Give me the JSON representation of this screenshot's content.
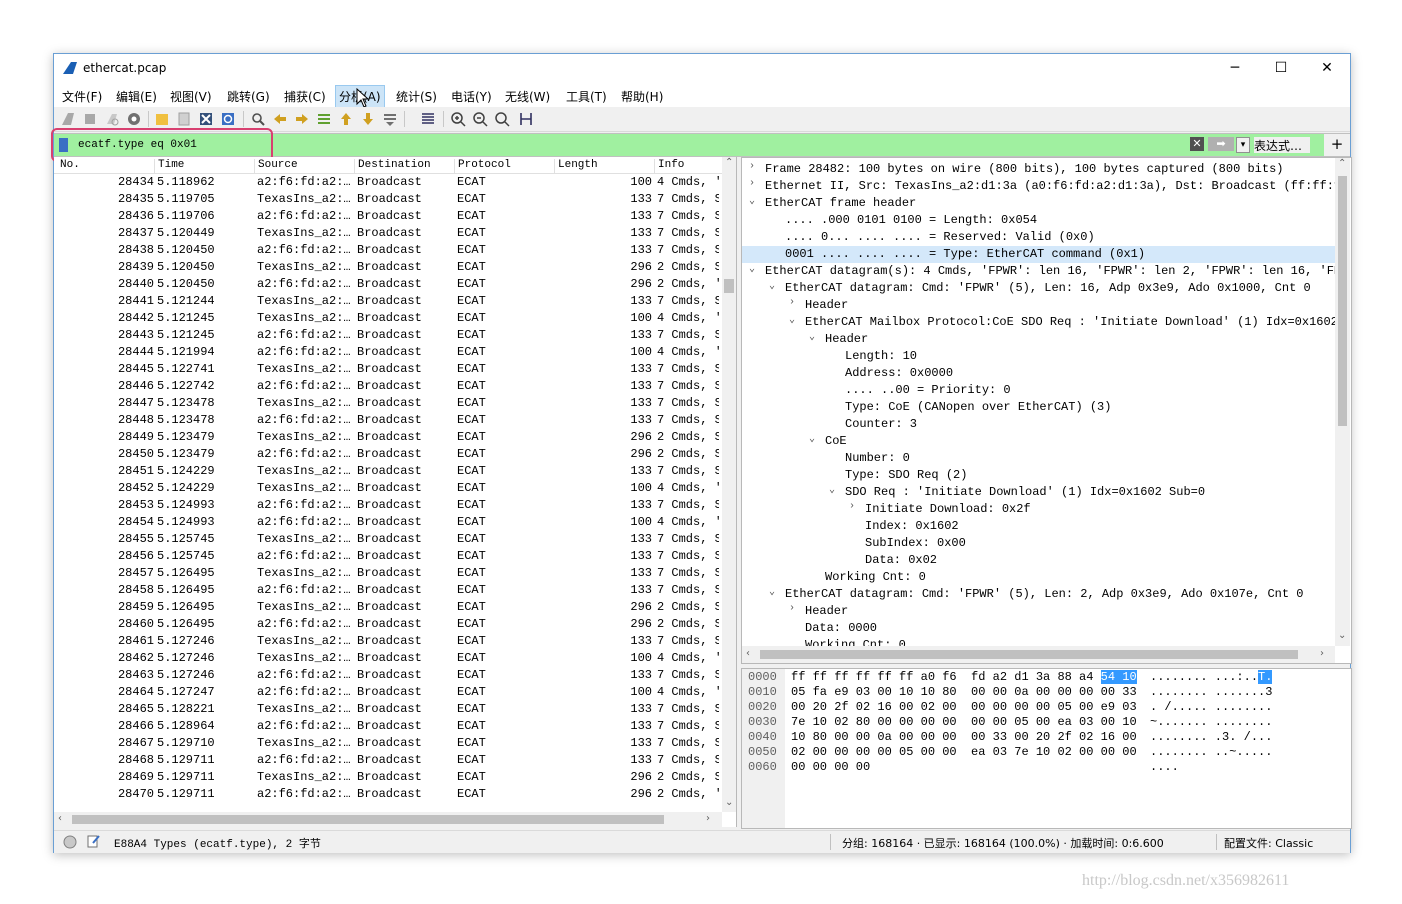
{
  "window": {
    "title": "ethercat.pcap",
    "controls": {
      "minimize": "─",
      "maximize": "☐",
      "close": "✕"
    }
  },
  "menu": [
    "文件(F)",
    "编辑(E)",
    "视图(V)",
    "跳转(G)",
    "捕获(C)",
    "分析(A)",
    "统计(S)",
    "电话(Y)",
    "无线(W)",
    "工具(T)",
    "帮助(H)"
  ],
  "filter": {
    "value": "ecatf.type eq 0x01",
    "expression_label": "表达式…",
    "add_label": "+",
    "clear_label": "✕",
    "apply_label": "➡",
    "dropdown_label": "▾"
  },
  "packet_list": {
    "columns": [
      "No.",
      "Time",
      "Source",
      "Destination",
      "Protocol",
      "Length",
      "Info"
    ],
    "rows": [
      [
        "28434",
        "5.118962",
        "a2:f6:fd:a2:…",
        "Broadcast",
        "ECAT",
        "100",
        "4 Cmds, '"
      ],
      [
        "28435",
        "5.119705",
        "TexasIns_a2:…",
        "Broadcast",
        "ECAT",
        "133",
        "7 Cmds, S"
      ],
      [
        "28436",
        "5.119706",
        "a2:f6:fd:a2:…",
        "Broadcast",
        "ECAT",
        "133",
        "7 Cmds, S"
      ],
      [
        "28437",
        "5.120449",
        "TexasIns_a2:…",
        "Broadcast",
        "ECAT",
        "133",
        "7 Cmds, S"
      ],
      [
        "28438",
        "5.120450",
        "a2:f6:fd:a2:…",
        "Broadcast",
        "ECAT",
        "133",
        "7 Cmds, S"
      ],
      [
        "28439",
        "5.120450",
        "TexasIns_a2:…",
        "Broadcast",
        "ECAT",
        "296",
        "2 Cmds, S"
      ],
      [
        "28440",
        "5.120450",
        "a2:f6:fd:a2:…",
        "Broadcast",
        "ECAT",
        "296",
        "2 Cmds, '"
      ],
      [
        "28441",
        "5.121244",
        "TexasIns_a2:…",
        "Broadcast",
        "ECAT",
        "133",
        "7 Cmds, S"
      ],
      [
        "28442",
        "5.121245",
        "TexasIns_a2:…",
        "Broadcast",
        "ECAT",
        "100",
        "4 Cmds, '"
      ],
      [
        "28443",
        "5.121245",
        "a2:f6:fd:a2:…",
        "Broadcast",
        "ECAT",
        "133",
        "7 Cmds, S"
      ],
      [
        "28444",
        "5.121994",
        "a2:f6:fd:a2:…",
        "Broadcast",
        "ECAT",
        "100",
        "4 Cmds, '"
      ],
      [
        "28445",
        "5.122741",
        "TexasIns_a2:…",
        "Broadcast",
        "ECAT",
        "133",
        "7 Cmds, S"
      ],
      [
        "28446",
        "5.122742",
        "a2:f6:fd:a2:…",
        "Broadcast",
        "ECAT",
        "133",
        "7 Cmds, S"
      ],
      [
        "28447",
        "5.123478",
        "TexasIns_a2:…",
        "Broadcast",
        "ECAT",
        "133",
        "7 Cmds, S"
      ],
      [
        "28448",
        "5.123478",
        "a2:f6:fd:a2:…",
        "Broadcast",
        "ECAT",
        "133",
        "7 Cmds, S"
      ],
      [
        "28449",
        "5.123479",
        "TexasIns_a2:…",
        "Broadcast",
        "ECAT",
        "296",
        "2 Cmds, S"
      ],
      [
        "28450",
        "5.123479",
        "a2:f6:fd:a2:…",
        "Broadcast",
        "ECAT",
        "296",
        "2 Cmds, S"
      ],
      [
        "28451",
        "5.124229",
        "TexasIns_a2:…",
        "Broadcast",
        "ECAT",
        "133",
        "7 Cmds, S"
      ],
      [
        "28452",
        "5.124229",
        "TexasIns_a2:…",
        "Broadcast",
        "ECAT",
        "100",
        "4 Cmds, '"
      ],
      [
        "28453",
        "5.124993",
        "a2:f6:fd:a2:…",
        "Broadcast",
        "ECAT",
        "133",
        "7 Cmds, S"
      ],
      [
        "28454",
        "5.124993",
        "a2:f6:fd:a2:…",
        "Broadcast",
        "ECAT",
        "100",
        "4 Cmds, '"
      ],
      [
        "28455",
        "5.125745",
        "TexasIns_a2:…",
        "Broadcast",
        "ECAT",
        "133",
        "7 Cmds, S"
      ],
      [
        "28456",
        "5.125745",
        "a2:f6:fd:a2:…",
        "Broadcast",
        "ECAT",
        "133",
        "7 Cmds, S"
      ],
      [
        "28457",
        "5.126495",
        "TexasIns_a2:…",
        "Broadcast",
        "ECAT",
        "133",
        "7 Cmds, S"
      ],
      [
        "28458",
        "5.126495",
        "a2:f6:fd:a2:…",
        "Broadcast",
        "ECAT",
        "133",
        "7 Cmds, S"
      ],
      [
        "28459",
        "5.126495",
        "TexasIns_a2:…",
        "Broadcast",
        "ECAT",
        "296",
        "2 Cmds, S"
      ],
      [
        "28460",
        "5.126495",
        "a2:f6:fd:a2:…",
        "Broadcast",
        "ECAT",
        "296",
        "2 Cmds, S"
      ],
      [
        "28461",
        "5.127246",
        "TexasIns_a2:…",
        "Broadcast",
        "ECAT",
        "133",
        "7 Cmds, S"
      ],
      [
        "28462",
        "5.127246",
        "TexasIns_a2:…",
        "Broadcast",
        "ECAT",
        "100",
        "4 Cmds, '"
      ],
      [
        "28463",
        "5.127246",
        "a2:f6:fd:a2:…",
        "Broadcast",
        "ECAT",
        "133",
        "7 Cmds, S"
      ],
      [
        "28464",
        "5.127247",
        "a2:f6:fd:a2:…",
        "Broadcast",
        "ECAT",
        "100",
        "4 Cmds, '"
      ],
      [
        "28465",
        "5.128221",
        "TexasIns_a2:…",
        "Broadcast",
        "ECAT",
        "133",
        "7 Cmds, S"
      ],
      [
        "28466",
        "5.128964",
        "a2:f6:fd:a2:…",
        "Broadcast",
        "ECAT",
        "133",
        "7 Cmds, S"
      ],
      [
        "28467",
        "5.129710",
        "TexasIns_a2:…",
        "Broadcast",
        "ECAT",
        "133",
        "7 Cmds, S"
      ],
      [
        "28468",
        "5.129711",
        "a2:f6:fd:a2:…",
        "Broadcast",
        "ECAT",
        "133",
        "7 Cmds, S"
      ],
      [
        "28469",
        "5.129711",
        "TexasIns_a2:…",
        "Broadcast",
        "ECAT",
        "296",
        "2 Cmds, S"
      ],
      [
        "28470",
        "5.129711",
        "a2:f6:fd:a2:…",
        "Broadcast",
        "ECAT",
        "296",
        "2 Cmds, '"
      ]
    ]
  },
  "details": [
    {
      "text": "Frame 28482: 100 bytes on wire (800 bits), 100 bytes captured (800 bits)",
      "depth": 0,
      "twist": "›"
    },
    {
      "text": "Ethernet II, Src: TexasIns_a2:d1:3a (a0:f6:fd:a2:d1:3a), Dst: Broadcast (ff:ff:ff",
      "depth": 0,
      "twist": "›"
    },
    {
      "text": "EtherCAT frame header",
      "depth": 0,
      "twist": "⌄"
    },
    {
      "text": ".... .000 0101 0100 = Length: 0x054",
      "depth": 1,
      "twist": ""
    },
    {
      "text": ".... 0... .... .... = Reserved: Valid (0x0)",
      "depth": 1,
      "twist": ""
    },
    {
      "text": "0001 .... .... .... = Type: EtherCAT command (0x1)",
      "depth": 1,
      "twist": "",
      "selected": true
    },
    {
      "text": "EtherCAT datagram(s): 4 Cmds, 'FPWR': len 16, 'FPWR': len 2, 'FPWR': len 16, 'FPW",
      "depth": 0,
      "twist": "⌄"
    },
    {
      "text": "EtherCAT datagram: Cmd: 'FPWR' (5), Len: 16, Adp 0x3e9, Ado 0x1000, Cnt 0",
      "depth": 1,
      "twist": "⌄"
    },
    {
      "text": "Header",
      "depth": 2,
      "twist": "›"
    },
    {
      "text": "EtherCAT Mailbox Protocol:CoE SDO Req : 'Initiate Download' (1) Idx=0x1602 S",
      "depth": 2,
      "twist": "⌄"
    },
    {
      "text": "Header",
      "depth": 3,
      "twist": "⌄"
    },
    {
      "text": "Length: 10",
      "depth": 4,
      "twist": ""
    },
    {
      "text": "Address: 0x0000",
      "depth": 4,
      "twist": ""
    },
    {
      "text": ".... ..00 = Priority: 0",
      "depth": 4,
      "twist": ""
    },
    {
      "text": "Type: CoE (CANopen over EtherCAT) (3)",
      "depth": 4,
      "twist": ""
    },
    {
      "text": "Counter: 3",
      "depth": 4,
      "twist": ""
    },
    {
      "text": "CoE",
      "depth": 3,
      "twist": "⌄"
    },
    {
      "text": "Number: 0",
      "depth": 4,
      "twist": ""
    },
    {
      "text": "Type: SDO Req (2)",
      "depth": 4,
      "twist": ""
    },
    {
      "text": "SDO Req : 'Initiate Download' (1) Idx=0x1602 Sub=0",
      "depth": 4,
      "twist": "⌄"
    },
    {
      "text": "Initiate Download: 0x2f",
      "depth": 5,
      "twist": "›"
    },
    {
      "text": "Index: 0x1602",
      "depth": 5,
      "twist": ""
    },
    {
      "text": "SubIndex: 0x00",
      "depth": 5,
      "twist": ""
    },
    {
      "text": "Data: 0x02",
      "depth": 5,
      "twist": ""
    },
    {
      "text": "Working Cnt: 0",
      "depth": 3,
      "twist": ""
    },
    {
      "text": "EtherCAT datagram: Cmd: 'FPWR' (5), Len: 2, Adp 0x3e9, Ado 0x107e, Cnt 0",
      "depth": 1,
      "twist": "⌄"
    },
    {
      "text": "Header",
      "depth": 2,
      "twist": "›"
    },
    {
      "text": "Data: 0000",
      "depth": 2,
      "twist": ""
    },
    {
      "text": "Working Cnt: 0",
      "depth": 2,
      "twist": ""
    }
  ],
  "hex": [
    {
      "off": "0000",
      "pre": "ff ff ff ff ff ff a0 f6  fd a2 d1 3a 88 a4 ",
      "hl": "54 10",
      "apre": "........ ...:..",
      "ahl": "T."
    },
    {
      "off": "0010",
      "pre": "05 fa e9 03 00 10 10 80  00 00 0a 00 00 00 00 33",
      "hl": "",
      "apre": "........ .......3",
      "ahl": ""
    },
    {
      "off": "0020",
      "pre": "00 20 2f 02 16 00 02 00  00 00 00 00 05 00 e9 03",
      "hl": "",
      "apre": ". /..... ........",
      "ahl": ""
    },
    {
      "off": "0030",
      "pre": "7e 10 02 80 00 00 00 00  00 00 05 00 ea 03 00 10",
      "hl": "",
      "apre": "~....... ........",
      "ahl": ""
    },
    {
      "off": "0040",
      "pre": "10 80 00 00 0a 00 00 00  00 33 00 20 2f 02 16 00",
      "hl": "",
      "apre": "........ .3. /...",
      "ahl": ""
    },
    {
      "off": "0050",
      "pre": "02 00 00 00 00 05 00 00  ea 03 7e 10 02 00 00 00",
      "hl": "",
      "apre": "........ ..~.....",
      "ahl": ""
    },
    {
      "off": "0060",
      "pre": "00 00 00 00",
      "hl": "",
      "apre": "....",
      "ahl": ""
    }
  ],
  "status": {
    "field_info": "E88A4 Types (ecatf.type), 2 字节",
    "packets": "分组: 168164 · 已显示: 168164 (100.0%) · 加载时间: 0:6.600",
    "profile": "配置文件: Classic"
  },
  "watermark": "http://blog.csdn.net/x356982611",
  "colors": {
    "filter_ok": "#a0f0a0",
    "selection": "#d4e8fa",
    "hex_highlight": "#3399ff",
    "annotation": "#d84070"
  }
}
